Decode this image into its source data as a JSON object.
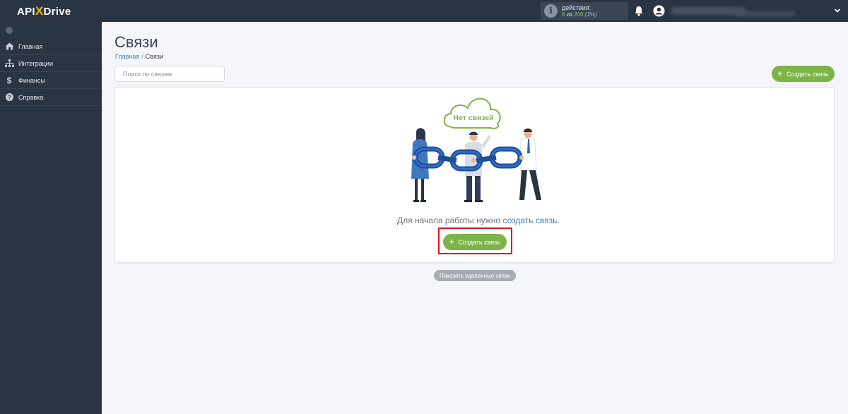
{
  "header": {
    "logo": {
      "left": "API",
      "x": "X",
      "right": "Drive"
    },
    "actions": {
      "label": "действия:",
      "used": "6",
      "of_word": "из",
      "total": "200",
      "percent": "(3%)"
    }
  },
  "sidebar": {
    "items": [
      {
        "label": "Главная",
        "icon": "home-icon"
      },
      {
        "label": "Интеграции",
        "icon": "sitemap-icon"
      },
      {
        "label": "Финансы",
        "icon": "dollar-icon"
      },
      {
        "label": "Справка",
        "icon": "help-icon"
      }
    ]
  },
  "main": {
    "title": "Связи",
    "breadcrumb": {
      "home": "Главная",
      "separator": "/",
      "current": "Связи"
    },
    "search": {
      "placeholder": "Поиск по связям",
      "value": ""
    },
    "create_button": {
      "plus": "+",
      "label": "Создать связь"
    },
    "empty_state": {
      "cloud_text": "Нет связей",
      "message_prefix": "Для начала работы нужно ",
      "message_link": "создать связь",
      "message_suffix": ".",
      "button": {
        "plus": "+",
        "label": "Создать связь"
      }
    },
    "show_deleted_label": "Показать удаленные связи"
  },
  "colors": {
    "sidebar_bg": "#2b3442",
    "accent_green": "#7db44a",
    "link_blue": "#3f7fb8",
    "highlight_red": "#e0141e",
    "logo_x": "#f2b705"
  }
}
